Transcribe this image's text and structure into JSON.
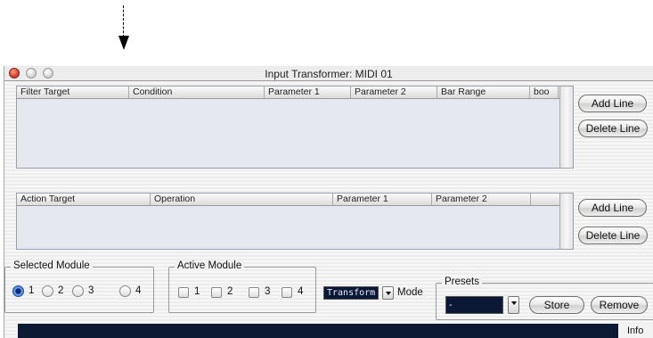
{
  "window": {
    "title": "Input Transformer: MIDI 01"
  },
  "filter_table": {
    "columns": [
      "Filter Target",
      "Condition",
      "Parameter 1",
      "Parameter 2",
      "Bar Range",
      "boo"
    ],
    "rows": [],
    "add_label": "Add Line",
    "delete_label": "Delete Line"
  },
  "action_table": {
    "columns": [
      "Action Target",
      "Operation",
      "Parameter 1",
      "Parameter 2"
    ],
    "rows": [],
    "add_label": "Add Line",
    "delete_label": "Delete Line"
  },
  "selected_module": {
    "label": "Selected Module",
    "options": [
      "1",
      "2",
      "3",
      "4"
    ],
    "selected": "1"
  },
  "active_module": {
    "label": "Active Module",
    "options": [
      "1",
      "2",
      "3",
      "4"
    ],
    "checked": []
  },
  "mode": {
    "value": "Transform",
    "label": "Mode"
  },
  "presets": {
    "label": "Presets",
    "value": "-",
    "store_label": "Store",
    "remove_label": "Remove"
  },
  "info": {
    "label": "Info"
  },
  "colors": {
    "accent_blue": "#3c78d8",
    "dark_field": "#0a1735",
    "close_red": "#d0321e"
  }
}
